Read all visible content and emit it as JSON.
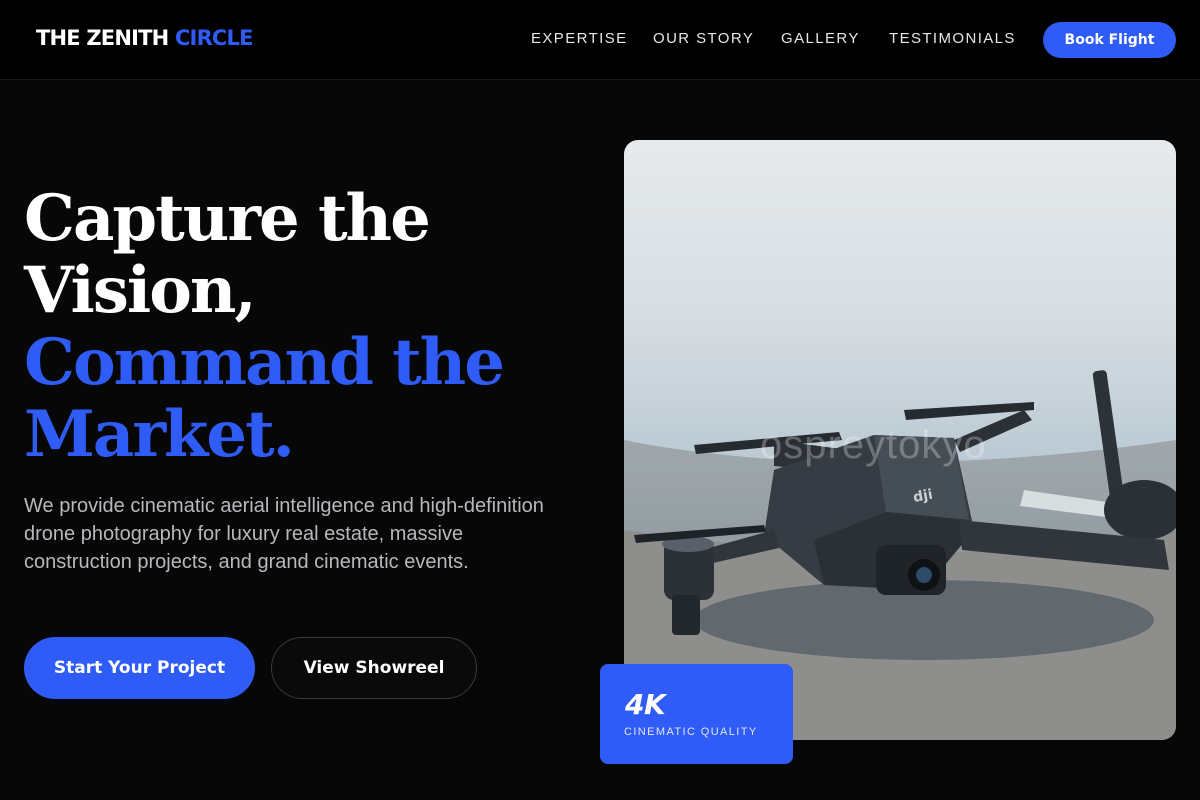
{
  "nav": {
    "logo_main": "THE ZENITH",
    "logo_accent": "CIRCLE",
    "links": [
      "EXPERTISE",
      "OUR STORY",
      "GALLERY",
      "TESTIMONIALS"
    ],
    "cta_label": "Book Flight"
  },
  "hero": {
    "headline_line1": "Capture the",
    "headline_line2": "Vision,",
    "headline_line3": "Command the",
    "headline_line4": "Market.",
    "description": "We provide cinematic aerial intelligence and high-definition drone photography for luxury real estate, massive construction projects, and grand cinematic events.",
    "primary_button": "Start Your Project",
    "secondary_button": "View Showreel",
    "image_watermark": "ospreytokyo",
    "badge_title": "4K",
    "badge_subtitle": "CINEMATIC QUALITY"
  },
  "colors": {
    "accent": "#2f5cf6",
    "background": "#070708",
    "text_primary": "#ffffff",
    "text_muted": "#b8b8bd"
  }
}
